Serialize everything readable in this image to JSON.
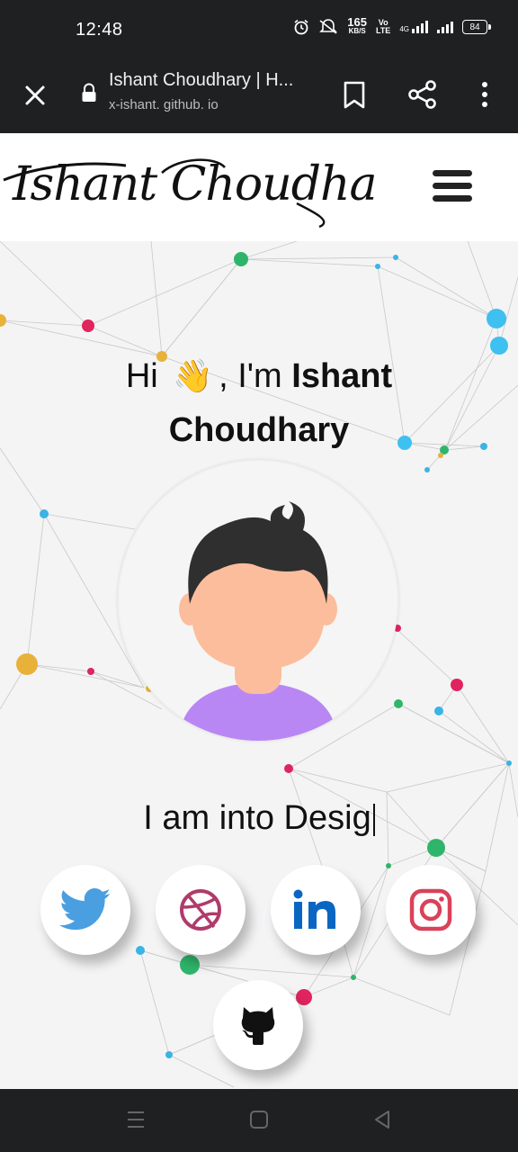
{
  "status_bar": {
    "time": "12:48",
    "speed_value": "165",
    "speed_unit": "KB/S",
    "volte_top": "Vo",
    "volte_bottom": "LTE",
    "network": "4G",
    "battery": "84"
  },
  "browser": {
    "title": "Ishant Choudhary | H...",
    "url": "x-ishant. github. io"
  },
  "site": {
    "logo_text": "Ishant Choudhary",
    "greeting_prefix": "Hi",
    "greeting_wave": "👋",
    "greeting_mid": ", I'm",
    "greeting_first": "Ishant",
    "greeting_last": "Choudhary",
    "typed_text": "I am into Desig"
  },
  "social": [
    "twitter",
    "dribbble",
    "linkedin",
    "instagram",
    "github"
  ],
  "colors": {
    "twitter": "#4a9fe0",
    "dribbble": "#b03b6b",
    "linkedin": "#0a66c2",
    "instagram": "#d9425a",
    "github": "#111111",
    "avatar_shirt": "#b987f4",
    "avatar_skin": "#fcbd9c",
    "avatar_hair": "#2f2f2f"
  }
}
